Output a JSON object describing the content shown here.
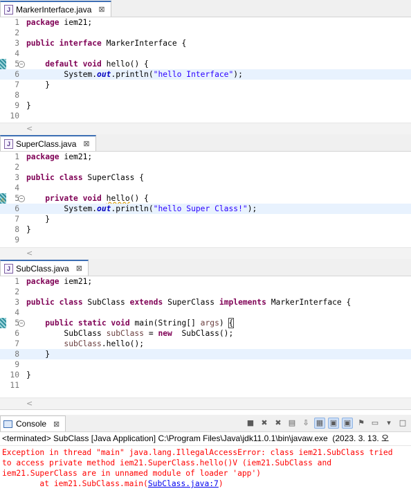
{
  "editors": [
    {
      "tab": "MarkerInterface.java",
      "lines": [
        {
          "n": "1",
          "t": [
            [
              "kw",
              "package"
            ],
            [
              "",
              "iem21;"
            ]
          ]
        },
        {
          "n": "2",
          "t": []
        },
        {
          "n": "3",
          "t": [
            [
              "kw",
              "public interface"
            ],
            [
              "",
              "MarkerInterface {"
            ]
          ]
        },
        {
          "n": "4",
          "t": []
        },
        {
          "n": "5",
          "fold": true,
          "t": [
            [
              "",
              "    "
            ],
            [
              "kw",
              "default void"
            ],
            [
              "",
              "hello() {"
            ]
          ]
        },
        {
          "n": "6",
          "hl": true,
          "t": [
            [
              "",
              "        System."
            ],
            [
              "fld",
              "out"
            ],
            [
              "",
              ".println("
            ],
            [
              "str",
              "\"hello Interface\""
            ],
            [
              "",
              ");"
            ]
          ]
        },
        {
          "n": "7",
          "t": [
            [
              "",
              "    }"
            ]
          ]
        },
        {
          "n": "8",
          "t": []
        },
        {
          "n": "9",
          "t": [
            [
              "",
              "}"
            ]
          ]
        },
        {
          "n": "10",
          "t": []
        }
      ]
    },
    {
      "tab": "SuperClass.java",
      "lines": [
        {
          "n": "1",
          "t": [
            [
              "kw",
              "package"
            ],
            [
              "",
              "iem21;"
            ]
          ]
        },
        {
          "n": "2",
          "t": []
        },
        {
          "n": "3",
          "t": [
            [
              "kw",
              "public class"
            ],
            [
              "",
              "SuperClass {"
            ]
          ]
        },
        {
          "n": "4",
          "t": []
        },
        {
          "n": "5",
          "fold": true,
          "warn": true,
          "t": [
            [
              "",
              "    "
            ],
            [
              "kw",
              "private void"
            ],
            [
              "wavy",
              "hello"
            ],
            [
              "",
              "() {"
            ]
          ]
        },
        {
          "n": "6",
          "hl": true,
          "t": [
            [
              "",
              "        System."
            ],
            [
              "fld",
              "out"
            ],
            [
              "",
              ".println("
            ],
            [
              "str",
              "\"hello Super Class!\""
            ],
            [
              "",
              ");"
            ]
          ]
        },
        {
          "n": "7",
          "t": [
            [
              "",
              "    }"
            ]
          ]
        },
        {
          "n": "8",
          "t": [
            [
              "",
              "}"
            ]
          ]
        },
        {
          "n": "9",
          "t": []
        }
      ]
    },
    {
      "tab": "SubClass.java",
      "lines": [
        {
          "n": "1",
          "t": [
            [
              "kw",
              "package"
            ],
            [
              "",
              "iem21;"
            ]
          ]
        },
        {
          "n": "2",
          "t": []
        },
        {
          "n": "3",
          "t": [
            [
              "kw",
              "public class"
            ],
            [
              "",
              "SubClass "
            ],
            [
              "kw",
              "extends"
            ],
            [
              "",
              "SuperClass "
            ],
            [
              "kw",
              "implements"
            ],
            [
              "",
              "MarkerInterface {"
            ]
          ]
        },
        {
          "n": "4",
          "t": []
        },
        {
          "n": "5",
          "fold": true,
          "t": [
            [
              "",
              "    "
            ],
            [
              "kw",
              "public static void"
            ],
            [
              "",
              "main(String[] "
            ],
            [
              "var",
              "args"
            ],
            [
              "",
              ") "
            ],
            [
              "brk",
              "{"
            ]
          ]
        },
        {
          "n": "6",
          "t": [
            [
              "",
              "        SubClass "
            ],
            [
              "var",
              "subClass"
            ],
            [
              "",
              " = "
            ],
            [
              "kw",
              "new"
            ],
            [
              "",
              " SubClass();"
            ]
          ]
        },
        {
          "n": "7",
          "t": [
            [
              "",
              "        "
            ],
            [
              "var",
              "subClass"
            ],
            [
              "",
              ".hello();"
            ]
          ]
        },
        {
          "n": "8",
          "hl": true,
          "t": [
            [
              "",
              "    }"
            ]
          ]
        },
        {
          "n": "9",
          "t": []
        },
        {
          "n": "10",
          "t": [
            [
              "",
              "}"
            ]
          ]
        },
        {
          "n": "11",
          "t": []
        }
      ]
    }
  ],
  "console": {
    "tab": "Console",
    "status": "<terminated> SubClass [Java Application] C:\\Program Files\\Java\\jdk11.0.1\\bin\\javaw.exe  (2023. 3. 13. 오",
    "output": [
      "Exception in thread \"main\" java.lang.IllegalAccessError: class iem21.SubClass tried",
      "to access private method iem21.SuperClass.hello()V (iem21.SubClass and",
      "iem21.SuperClass are in unnamed module of loader 'app')",
      "        at iem21.SubClass.main("
    ],
    "link": "SubClass.java:7",
    "output_tail": ")"
  },
  "icons": {
    "java_file": "J",
    "close": "⊠",
    "scroll_left": "<",
    "fold": "−",
    "warning": "⚠"
  }
}
